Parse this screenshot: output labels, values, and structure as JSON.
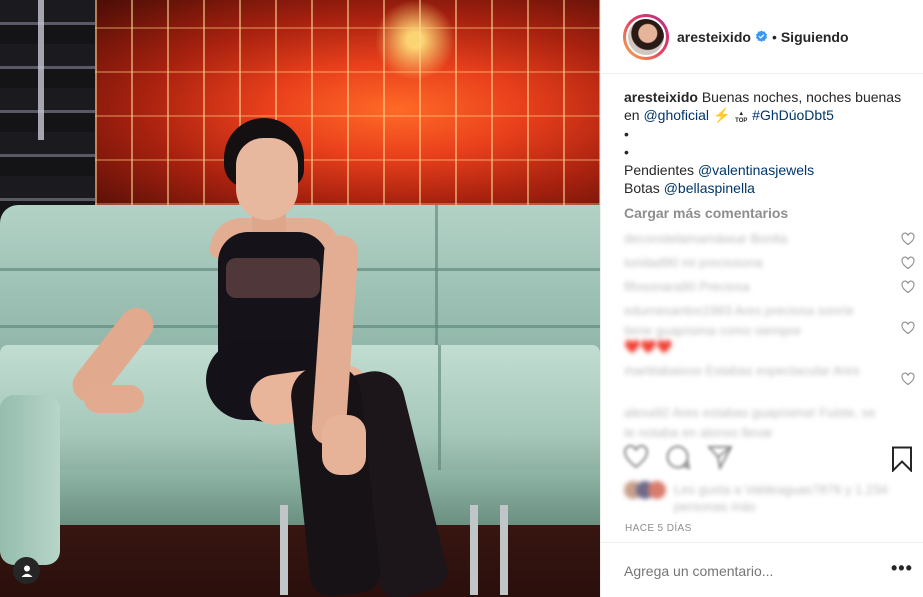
{
  "post": {
    "username": "aresteixido",
    "separator": "•",
    "follow_label": "Siguiendo",
    "caption": {
      "username": "aresteixido",
      "text1": "Buenas noches, noches buenas en",
      "mention1": "@ghoficial",
      "bolt": "⚡",
      "top_label": "TOP",
      "hashtag": "#GhDúoDbt5",
      "bullet1": "•",
      "bullet2": "•",
      "line_pendientes": "Pendientes",
      "mention_pendientes": "@valentinasjewels",
      "line_botas": "Botas",
      "mention_botas": "@bellaspinella"
    },
    "load_more": "Cargar más comentarios",
    "comments": [
      "deconstelamamáwue Bonita",
      "toridad90 mi preciosona",
      "fifosonara90 Preciosa",
      "edurnesantos1983 Ares preciosa sonríe tiene guapísima como siempre",
      "❤️❤️❤️",
      "martitabaixoo Estabas espectacular Ares",
      "alexa92 Ares estabas guapísima! Fuiste, se te notaba en alonso llevar"
    ],
    "likes_text": "Les gusta a Valdeaguas7876 y 1.234 personas más",
    "time": "HACE 5 DÍAS",
    "add_comment_placeholder": "Agrega un comentario...",
    "more_label": "•••"
  },
  "colors": {
    "text": "#262626",
    "link": "#003569",
    "muted": "#8e8e8e",
    "verified": "#3897f0",
    "border": "#efefef"
  },
  "icons": [
    "verified-badge-icon",
    "heart-icon",
    "comment-icon",
    "share-icon",
    "bookmark-icon",
    "user-tag-icon",
    "more-options-icon"
  ]
}
